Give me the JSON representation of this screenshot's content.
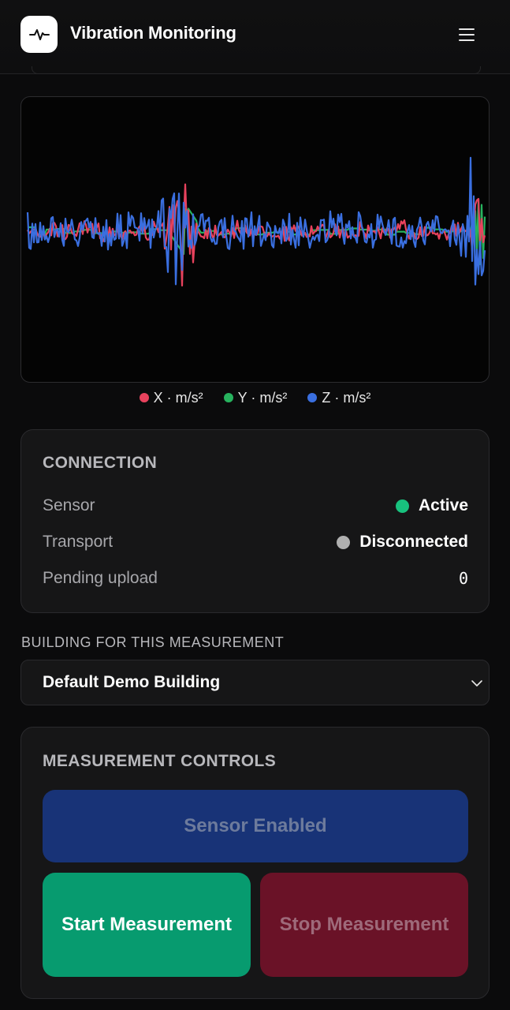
{
  "header": {
    "title": "Vibration Monitoring",
    "logo_icon": "pulse-icon",
    "menu_icon": "hamburger-menu-icon"
  },
  "chart": {
    "legend": [
      {
        "label": "X · m/s²",
        "color": "#e8425d"
      },
      {
        "label": "Y · m/s²",
        "color": "#27b35e"
      },
      {
        "label": "Z · m/s²",
        "color": "#3a6fe0"
      }
    ]
  },
  "connection": {
    "heading": "CONNECTION",
    "rows": [
      {
        "label": "Sensor",
        "value": "Active",
        "status_color": "#18c27e"
      },
      {
        "label": "Transport",
        "value": "Disconnected",
        "status_color": "#b0b0b0"
      },
      {
        "label": "Pending upload",
        "value": "0"
      }
    ]
  },
  "building": {
    "label": "BUILDING FOR THIS MEASUREMENT",
    "selected": "Default Demo Building",
    "chevron_icon": "chevron-down-icon"
  },
  "controls": {
    "heading": "MEASUREMENT CONTROLS",
    "sensor_button": "Sensor Enabled",
    "start_button": "Start Measurement",
    "stop_button": "Stop Measurement"
  }
}
